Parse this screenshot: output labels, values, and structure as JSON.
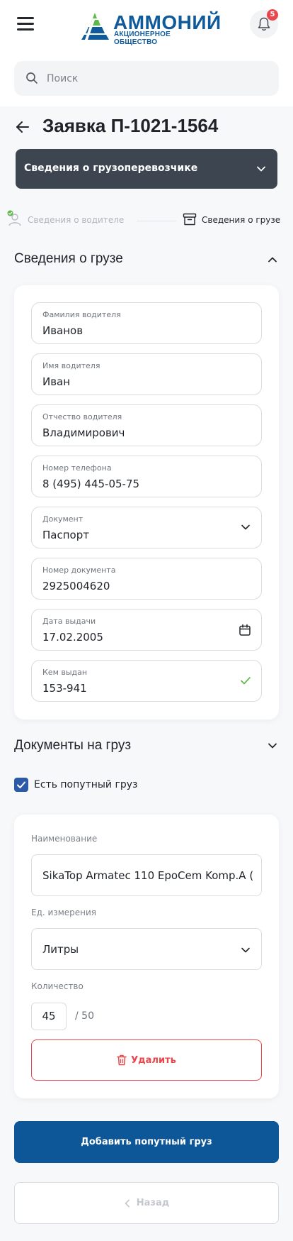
{
  "header": {
    "menu_icon": "hamburger-menu-icon",
    "logo_title": "АММОНИЙ",
    "logo_subtitle": "АКЦИОНЕРНОЕ ОБЩЕСТВО",
    "notification_icon": "bell-icon",
    "notification_count": "5"
  },
  "search": {
    "placeholder": "Поиск",
    "value": "",
    "icon": "search-icon"
  },
  "page": {
    "title": "Заявка П-1021-1564",
    "back_icon": "arrow-left-icon"
  },
  "carrier_select": {
    "label": "Сведения о грузоперевозчике",
    "icon": "chevron-down-icon"
  },
  "steps": [
    {
      "label": "Сведения о водителе",
      "status": "done",
      "icon": "user-check-icon"
    },
    {
      "label": "Сведения о грузе",
      "status": "active",
      "icon": "archive-box-icon"
    }
  ],
  "cargo_section": {
    "title": "Сведения о грузе",
    "expanded": true,
    "fields": [
      {
        "label": "Фамилия водителя",
        "value": "Иванов"
      },
      {
        "label": "Имя водителя",
        "value": "Иван"
      },
      {
        "label": "Отчество водителя",
        "value": "Владимирович"
      },
      {
        "label": "Номер телефона",
        "value": "8 (495) 445-05-75"
      },
      {
        "label": "Документ",
        "value": "Паспорт",
        "icon": "chevron-down-icon"
      },
      {
        "label": "Номер документа",
        "value": "2925004620"
      },
      {
        "label": "Дата выдачи",
        "value": "17.02.2005",
        "icon": "calendar-icon"
      },
      {
        "label": "Кем выдан",
        "value": "153-941",
        "icon": "check-icon"
      }
    ]
  },
  "documents_section": {
    "title": "Документы на груз",
    "expanded": false
  },
  "passing_cargo": {
    "checkbox_label": "Есть попутный груз",
    "checked": true,
    "name_label": "Наименование",
    "name_value": "SikaTop Armatec 110 EpoCem Komp.A (",
    "unit_label": "Ед. измерения",
    "unit_value": "Литры",
    "quantity_label": "Количество",
    "quantity_value": "45",
    "quantity_max": "/ 50",
    "delete_label": "Удалить"
  },
  "actions": {
    "add_label": "Добавить попутный груз",
    "back_label": "Назад"
  },
  "colors": {
    "brand": "#0f5a9a",
    "primary_button": "#0d5698",
    "danger": "#e9474b",
    "success": "#5fb84a",
    "dark_panel": "#3d4550"
  }
}
